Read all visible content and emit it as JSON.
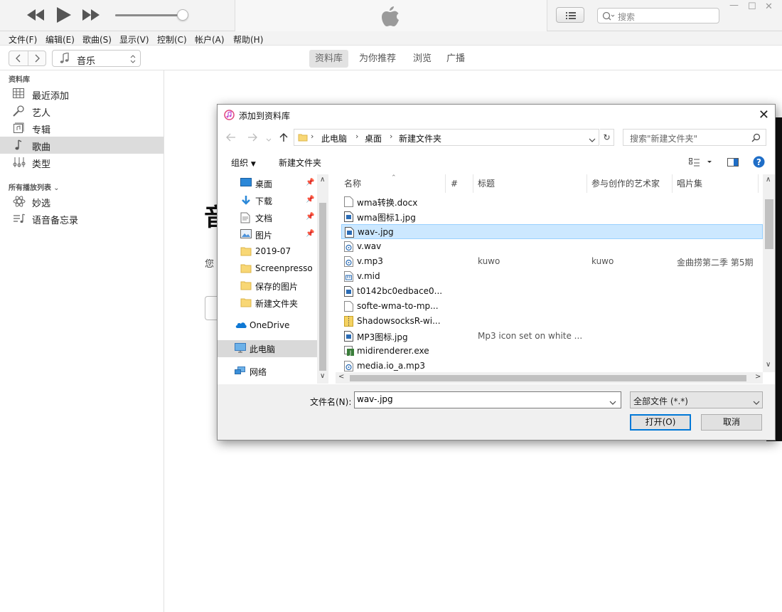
{
  "itunes": {
    "search_placeholder": "搜索",
    "menu": [
      "文件(F)",
      "编辑(E)",
      "歌曲(S)",
      "显示(V)",
      "控制(C)",
      "帐户(A)",
      "帮助(H)"
    ],
    "media_kind": "音乐",
    "tabs": [
      "资料库",
      "为你推荐",
      "浏览",
      "广播"
    ],
    "active_tab": "资料库",
    "sidebar": {
      "library_header": "资料库",
      "library_items": [
        {
          "label": "最近添加",
          "icon": "grid-icon"
        },
        {
          "label": "艺人",
          "icon": "microphone-icon"
        },
        {
          "label": "专辑",
          "icon": "album-icon"
        },
        {
          "label": "歌曲",
          "icon": "note-icon",
          "selected": true
        },
        {
          "label": "类型",
          "icon": "genre-icon"
        }
      ],
      "playlists_header": "所有播放列表",
      "playlist_items": [
        {
          "label": "妙选",
          "icon": "atom-icon"
        },
        {
          "label": "语音备忘录",
          "icon": "playlist-icon"
        }
      ]
    },
    "main_partial_title": "音",
    "main_partial_text": "您"
  },
  "dialog": {
    "title": "添加到资料库",
    "breadcrumb": [
      "此电脑",
      "桌面",
      "新建文件夹"
    ],
    "search_placeholder": "搜索\"新建文件夹\"",
    "organize": "组织",
    "new_folder": "新建文件夹",
    "nav_items": [
      {
        "label": "桌面",
        "icon": "desktop-icon",
        "pinned": true
      },
      {
        "label": "下载",
        "icon": "download-icon",
        "pinned": true
      },
      {
        "label": "文档",
        "icon": "document-icon",
        "pinned": true
      },
      {
        "label": "图片",
        "icon": "picture-icon",
        "pinned": true
      },
      {
        "label": "2019-07",
        "icon": "folder-icon"
      },
      {
        "label": "Screenpresso",
        "icon": "folder-icon"
      },
      {
        "label": "保存的图片",
        "icon": "folder-icon"
      },
      {
        "label": "新建文件夹",
        "icon": "folder-icon"
      },
      {
        "label": "OneDrive",
        "icon": "cloud-icon"
      },
      {
        "label": "此电脑",
        "icon": "computer-icon",
        "selected": true
      },
      {
        "label": "网络",
        "icon": "network-icon"
      }
    ],
    "columns": [
      "名称",
      "#",
      "标题",
      "参与创作的艺术家",
      "唱片集"
    ],
    "files": [
      {
        "name": "wma转换.docx",
        "icon": "doc-file-icon",
        "title": "",
        "artist": "",
        "album": ""
      },
      {
        "name": "wma图标1.jpg",
        "icon": "image-file-icon",
        "title": "",
        "artist": "",
        "album": ""
      },
      {
        "name": "wav-.jpg",
        "icon": "image-file-icon",
        "title": "",
        "artist": "",
        "album": "",
        "selected": true
      },
      {
        "name": "v.wav",
        "icon": "audio-file-icon",
        "title": "",
        "artist": "",
        "album": ""
      },
      {
        "name": "v.mp3",
        "icon": "audio-file-icon",
        "title": "kuwo",
        "artist": "kuwo",
        "album": "金曲捞第二季 第5期"
      },
      {
        "name": "v.mid",
        "icon": "midi-file-icon",
        "title": "",
        "artist": "",
        "album": ""
      },
      {
        "name": "t0142bc0edbace0...",
        "icon": "image-file-icon",
        "title": "",
        "artist": "",
        "album": ""
      },
      {
        "name": "softe-wma-to-mp...",
        "icon": "doc-file-icon",
        "title": "",
        "artist": "",
        "album": ""
      },
      {
        "name": "ShadowsocksR-wi...",
        "icon": "zip-file-icon",
        "title": "",
        "artist": "",
        "album": ""
      },
      {
        "name": "MP3图标.jpg",
        "icon": "image-file-icon",
        "title": "Mp3 icon set on white ...",
        "artist": "",
        "album": ""
      },
      {
        "name": "midirenderer.exe",
        "icon": "exe-file-icon",
        "title": "",
        "artist": "",
        "album": ""
      },
      {
        "name": "media.io_a.mp3",
        "icon": "audio-file-icon",
        "title": "",
        "artist": "",
        "album": ""
      }
    ],
    "filename_label": "文件名(N):",
    "filename_value": "wav-.jpg",
    "filter_value": "全部文件 (*.*)",
    "open_label": "打开(O)",
    "cancel_label": "取消"
  },
  "colors": {
    "selection": "#cce8ff",
    "accent": "#0078d7"
  }
}
